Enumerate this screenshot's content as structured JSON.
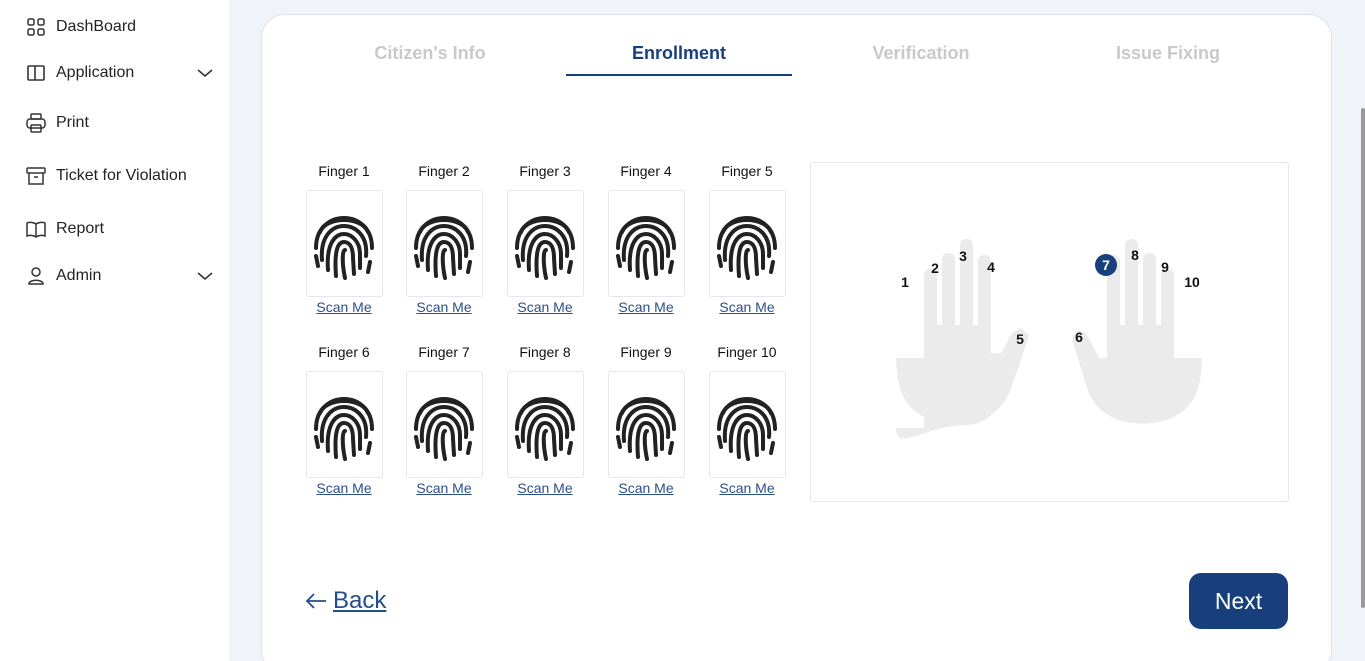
{
  "sidebar": {
    "items": [
      {
        "label": "DashBoard",
        "icon": "grid-icon",
        "expandable": false
      },
      {
        "label": "Application",
        "icon": "book-columns-icon",
        "expandable": true
      },
      {
        "label": "Print",
        "icon": "printer-icon",
        "expandable": false
      },
      {
        "label": "Ticket for Violation",
        "icon": "archive-box-icon",
        "expandable": false
      },
      {
        "label": "Report",
        "icon": "open-book-icon",
        "expandable": false
      },
      {
        "label": "Admin",
        "icon": "user-icon",
        "expandable": true
      }
    ]
  },
  "tabs": [
    {
      "label": "Citizen's Info",
      "active": false
    },
    {
      "label": "Enrollment",
      "active": true
    },
    {
      "label": "Verification",
      "active": false
    },
    {
      "label": "Issue Fixing",
      "active": false
    }
  ],
  "fingers": [
    {
      "label": "Finger 1",
      "link": "Scan Me"
    },
    {
      "label": "Finger 2",
      "link": "Scan Me"
    },
    {
      "label": "Finger 3",
      "link": "Scan Me"
    },
    {
      "label": "Finger 4",
      "link": "Scan Me"
    },
    {
      "label": "Finger 5",
      "link": "Scan Me"
    },
    {
      "label": "Finger 6",
      "link": "Scan Me"
    },
    {
      "label": "Finger 7",
      "link": "Scan Me"
    },
    {
      "label": "Finger 8",
      "link": "Scan Me"
    },
    {
      "label": "Finger 9",
      "link": "Scan Me"
    },
    {
      "label": "Finger 10",
      "link": "Scan Me"
    }
  ],
  "hands": {
    "numbers": [
      "1",
      "2",
      "3",
      "4",
      "5",
      "6",
      "7",
      "8",
      "9",
      "10"
    ],
    "selected": "7"
  },
  "footer": {
    "back_label": "Back",
    "next_label": "Next"
  },
  "colors": {
    "accent": "#173f7c",
    "tab_inactive": "#c7c9cd",
    "hand_fill": "#ebebeb",
    "link": "#2b4f89"
  }
}
